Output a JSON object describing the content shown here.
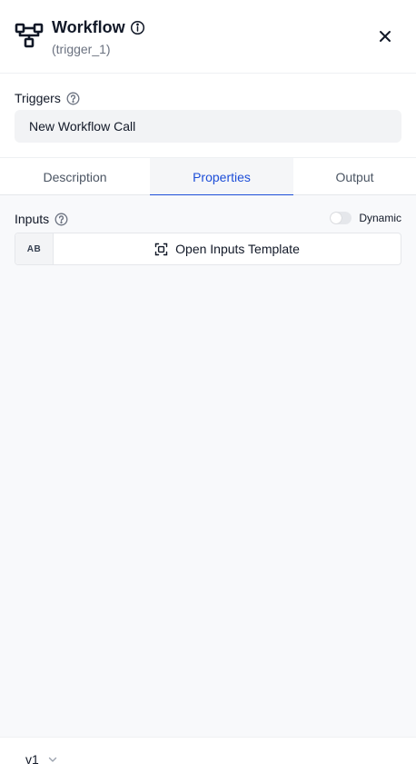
{
  "header": {
    "title": "Workflow",
    "subtitle": "(trigger_1)"
  },
  "triggers": {
    "label": "Triggers",
    "value": "New Workflow Call"
  },
  "tabs": [
    {
      "label": "Description",
      "active": false
    },
    {
      "label": "Properties",
      "active": true
    },
    {
      "label": "Output",
      "active": false
    }
  ],
  "inputs": {
    "label": "Inputs",
    "dynamic_label": "Dynamic",
    "dynamic_on": false,
    "type_badge": "AB",
    "template_button": "Open Inputs Template"
  },
  "footer": {
    "version": "v1"
  },
  "colors": {
    "accent": "#1d4ed8",
    "field_bg": "#f2f3f5",
    "content_bg": "#f8f9fb"
  },
  "icons": {
    "workflow": "workflow-icon",
    "info": "info-icon",
    "close": "close-icon",
    "help": "help-circle-icon",
    "focus": "focus-frame-icon",
    "chevron": "chevron-down-icon"
  }
}
